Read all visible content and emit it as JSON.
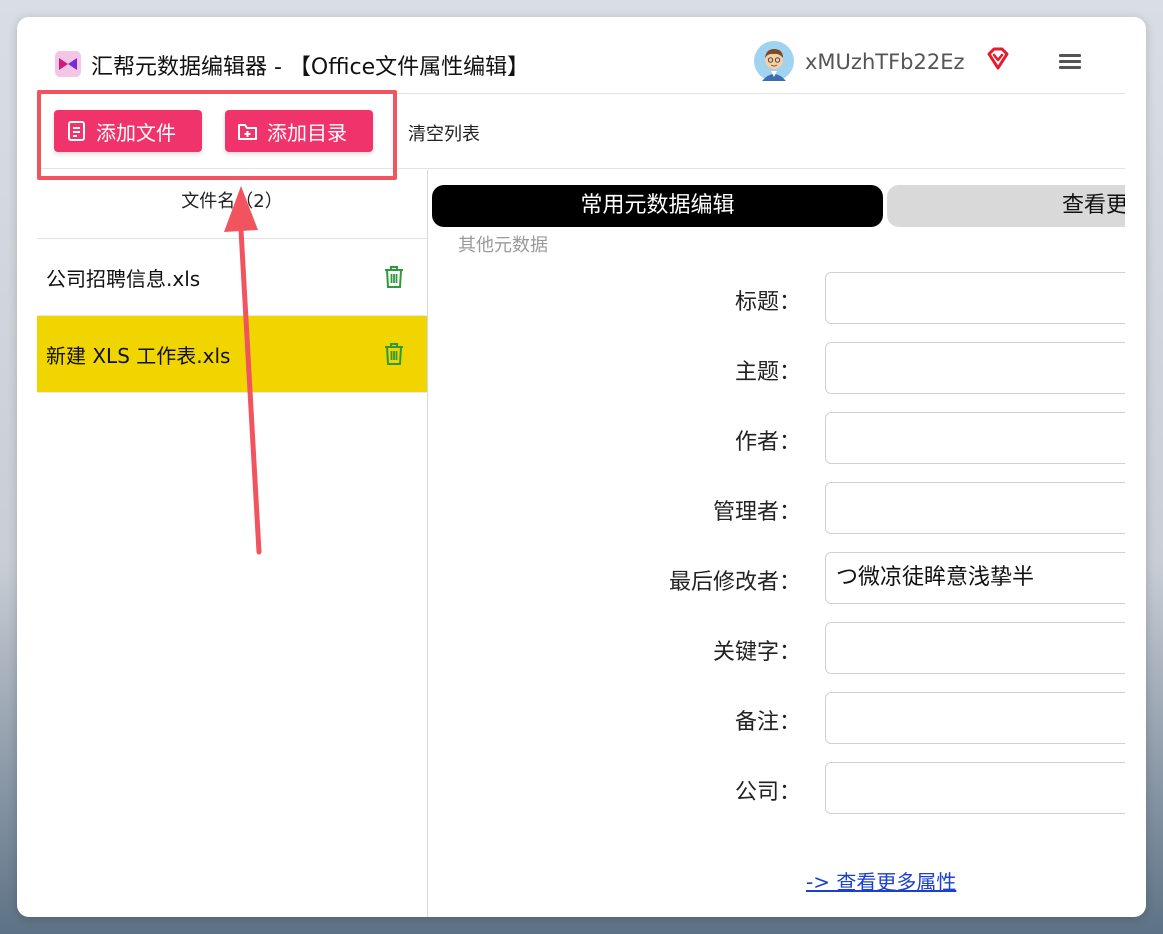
{
  "app": {
    "title": "汇帮元数据编辑器 - 【Office文件属性编辑】",
    "username": "xMUzhTFb22Ez"
  },
  "toolbar": {
    "add_file_label": "添加文件",
    "add_dir_label": "添加目录",
    "clear_list_label": "清空列表"
  },
  "file_list": {
    "header": "文件名（2）",
    "files": [
      {
        "name": "公司招聘信息.xls",
        "selected": false
      },
      {
        "name": "新建 XLS 工作表.xls",
        "selected": true
      }
    ]
  },
  "tabs": {
    "active": "常用元数据编辑",
    "inactive": "查看更",
    "secondary": "其他元数据"
  },
  "form": {
    "fields": [
      {
        "label": "标题：",
        "value": ""
      },
      {
        "label": "主题：",
        "value": ""
      },
      {
        "label": "作者：",
        "value": ""
      },
      {
        "label": "管理者：",
        "value": ""
      },
      {
        "label": "最后修改者：",
        "value": "つ微凉徒眸意浅挚半"
      },
      {
        "label": "关键字：",
        "value": ""
      },
      {
        "label": "备注：",
        "value": ""
      },
      {
        "label": "公司：",
        "value": ""
      }
    ],
    "more_link": "-> 查看更多属性"
  },
  "colors": {
    "accent_button": "#f0346b",
    "selected_row": "#f0d500",
    "annotation": "#f1545e"
  },
  "icons": {
    "logo": "app-logo-icon",
    "avatar": "user-avatar",
    "vip": "vip-diamond-icon",
    "menu": "hamburger-menu-icon",
    "add_file": "add-file-icon",
    "add_dir": "add-folder-icon",
    "delete": "trash-icon"
  }
}
